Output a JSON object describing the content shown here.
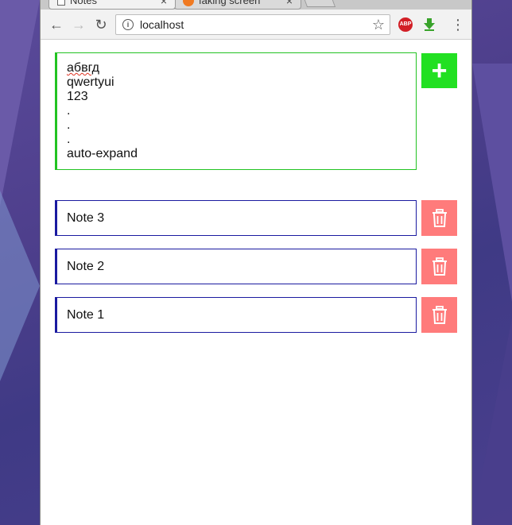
{
  "browser": {
    "tabs": [
      {
        "label": "Notes",
        "close": "×"
      },
      {
        "label": "faking screen",
        "close": "×"
      }
    ],
    "address": "localhost",
    "nav": {
      "back": "←",
      "forward": "→",
      "reload": "↻"
    },
    "star": "☆",
    "extensions": {
      "abp": "ABP",
      "abp_color": "#d21f26",
      "download_color": "#39a32b"
    },
    "menu": "⋮"
  },
  "app": {
    "editor": {
      "lines": [
        "абвгд",
        "qwertyui",
        "123",
        ".",
        ".",
        ".",
        "auto-expand"
      ],
      "border_color": "#22c322"
    },
    "add_button": {
      "label": "+",
      "color": "#22e022"
    },
    "notes": [
      {
        "text": "Note 3"
      },
      {
        "text": "Note 2"
      },
      {
        "text": "Note 1"
      }
    ],
    "note_border_color": "#1a1aa0",
    "delete_button_color": "#ff7b7b"
  }
}
